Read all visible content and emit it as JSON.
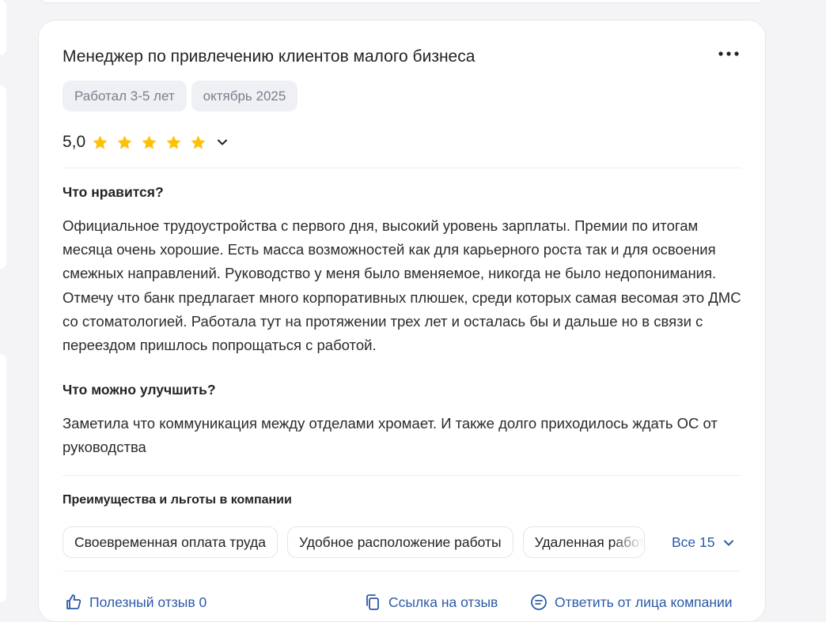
{
  "review": {
    "title": "Менеджер по привлечению клиентов малого бизнеса",
    "tenure": "Работал 3-5 лет",
    "date": "октябрь 2025",
    "rating_value": "5,0",
    "rating_stars": 5,
    "likes_heading": "Что нравится?",
    "likes_text": "Официальное трудоустройства с первого дня, высокий уровень зарплаты. Премии по итогам месяца очень хорошие. Есть масса возможностей как для карьерного роста так и для освоения смежных направлений. Руководство у меня было вменяемое, никогда не было недопонимания. Отмечу что банк предлагает много корпоративных плюшек, среди которых самая весомая это ДМС со стоматологией. Работала тут на протяжении трех лет и осталась бы и дальше но в связи с переездом пришлось попрощаться с работой.",
    "improve_heading": "Что можно улучшить?",
    "improve_text": "Заметила что коммуникация между отделами хромает. И также долго приходилось ждать ОС от руководства"
  },
  "benefits": {
    "heading": "Преимущества и льготы в компании",
    "items": [
      "Своевременная оплата труда",
      "Удобное расположение работы",
      "Удаленная работа"
    ],
    "all_label": "Все 15"
  },
  "footer": {
    "helpful": "Полезный отзыв 0",
    "link": "Ссылка на отзыв",
    "reply": "Ответить от лица компании"
  },
  "colors": {
    "star": "#ffc107",
    "link": "#2c5aa8",
    "chip_bg": "#eef0f4"
  },
  "icons": {
    "more": "more-dots-icon",
    "expand": "chevron-down-icon",
    "like": "thumbs-up-icon",
    "copy": "copy-link-icon",
    "reply": "chat-reply-icon"
  }
}
